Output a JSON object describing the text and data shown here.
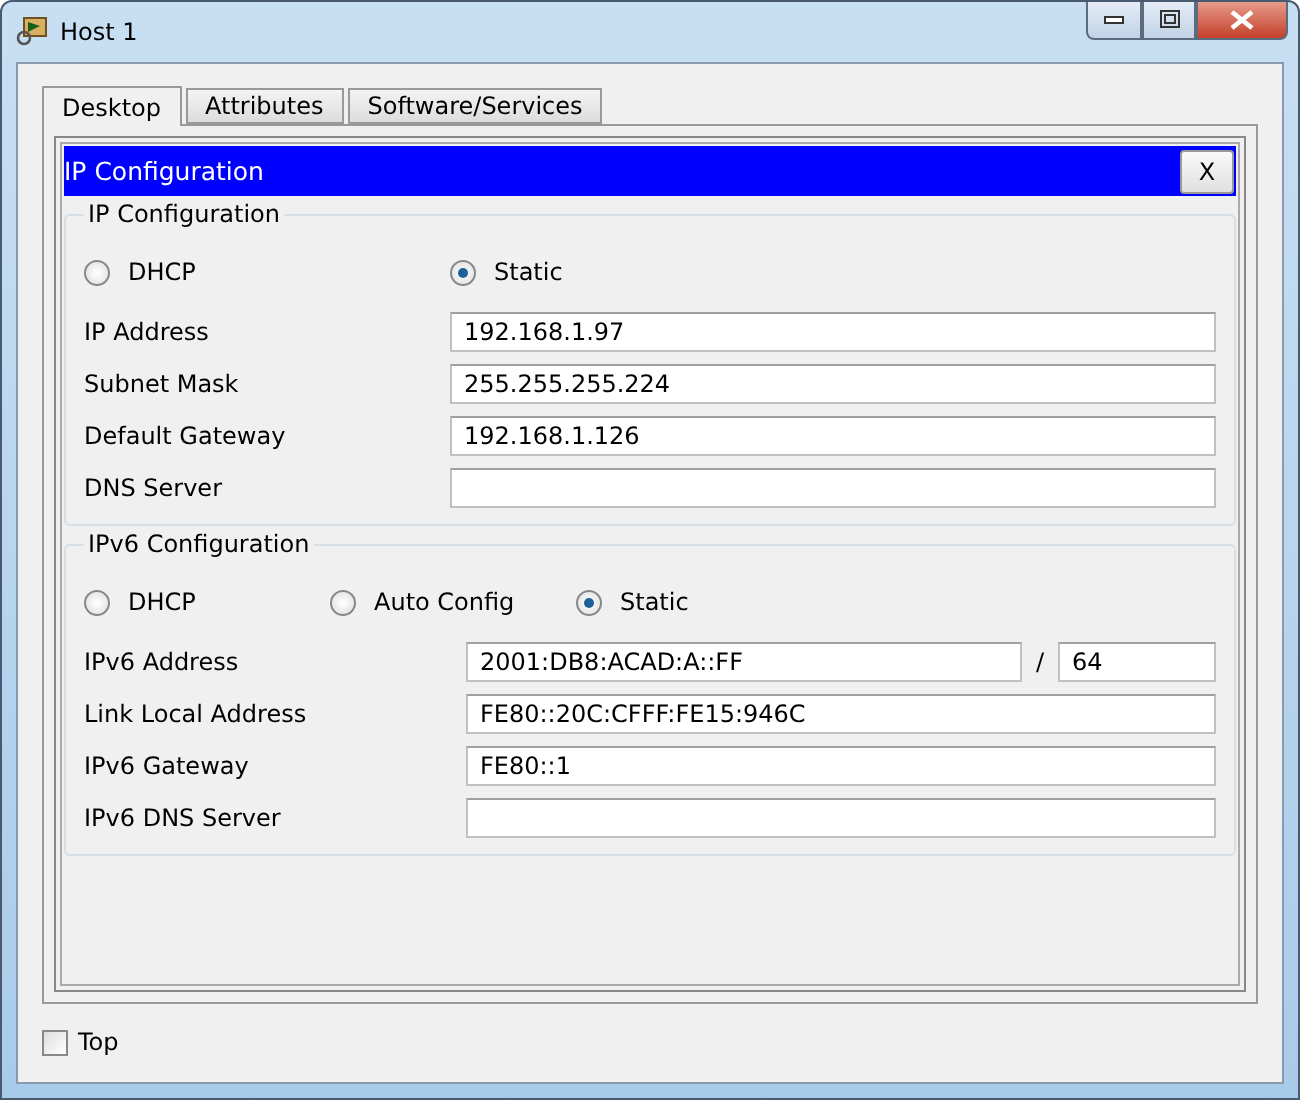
{
  "window": {
    "title": "Host 1"
  },
  "tabs": [
    {
      "label": "Desktop",
      "selected": true
    },
    {
      "label": "Attributes",
      "selected": false
    },
    {
      "label": "Software/Services",
      "selected": false
    }
  ],
  "panel": {
    "title": "IP Configuration",
    "close_label": "X"
  },
  "ipv4": {
    "legend": "IP Configuration",
    "modes": [
      {
        "label": "DHCP",
        "selected": false
      },
      {
        "label": "Static",
        "selected": true
      }
    ],
    "fields": [
      {
        "label": "IP Address",
        "value": "192.168.1.97"
      },
      {
        "label": "Subnet Mask",
        "value": "255.255.255.224"
      },
      {
        "label": "Default Gateway",
        "value": "192.168.1.126"
      },
      {
        "label": "DNS Server"
      }
    ]
  },
  "ipv6": {
    "legend": "IPv6 Configuration",
    "modes": [
      {
        "label": "DHCP",
        "selected": false
      },
      {
        "label": "Auto Config",
        "selected": false
      },
      {
        "label": "Static",
        "selected": true
      }
    ],
    "fields": [
      {
        "label": "IPv6 Address",
        "value": "2001:DB8:ACAD:A::FF",
        "separator": "/",
        "prefix": "64"
      },
      {
        "label": "Link Local Address",
        "value": "FE80::20C:CFFF:FE15:946C"
      },
      {
        "label": "IPv6 Gateway",
        "value": "FE80::1"
      },
      {
        "label": "IPv6 DNS Server"
      }
    ]
  },
  "top": {
    "label": "Top",
    "checked": false
  }
}
